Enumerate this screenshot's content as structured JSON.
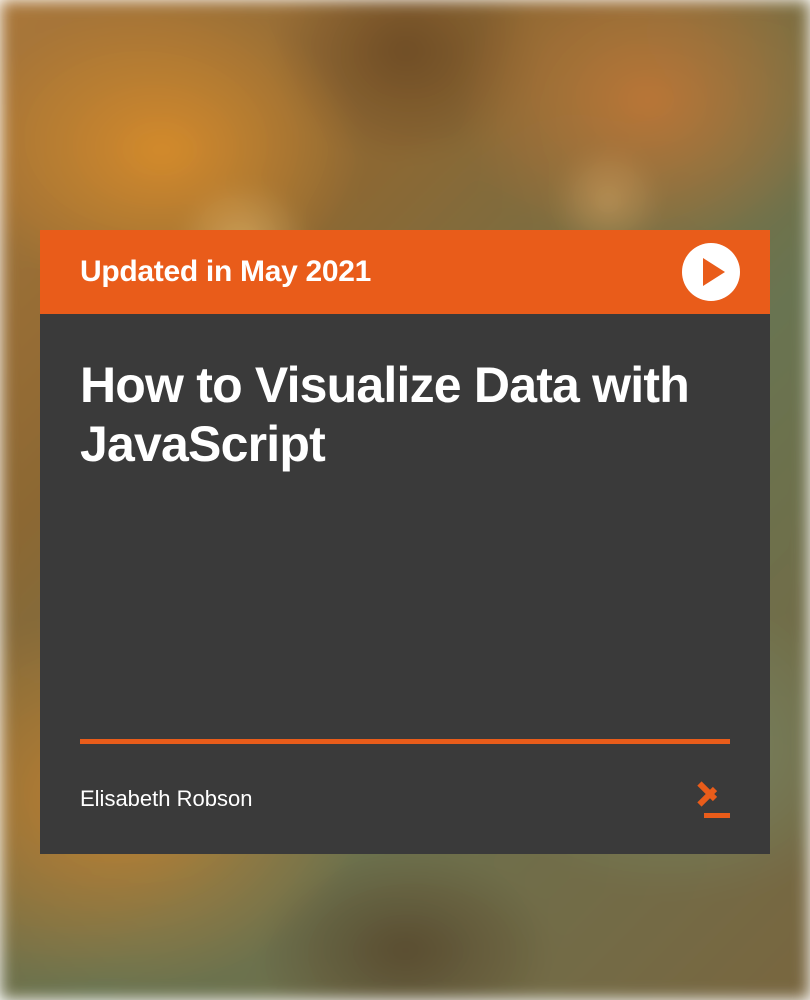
{
  "banner": {
    "update_text": "Updated in May 2021"
  },
  "course": {
    "title": "How to Visualize Data with JavaScript",
    "author": "Elisabeth Robson"
  },
  "colors": {
    "accent": "#e95c1a",
    "dark_bg": "#3a3a3a",
    "text": "#ffffff"
  }
}
